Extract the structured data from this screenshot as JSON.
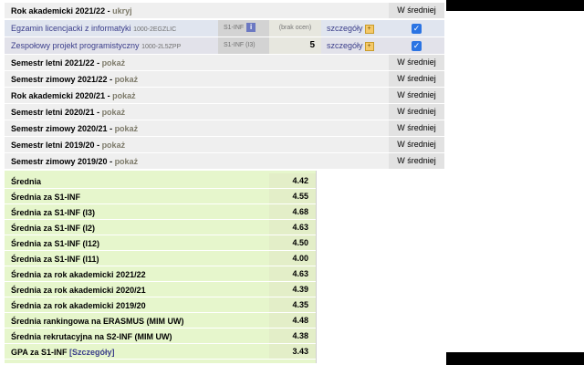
{
  "semesters": [
    {
      "name": "Rok akademicki 2021/22",
      "action": "ukryj",
      "avg_header": "W średniej"
    },
    {
      "name": "Semestr letni 2021/22",
      "action": "pokaż",
      "avg_header": "W średniej"
    },
    {
      "name": "Semestr zimowy 2021/22",
      "action": "pokaż",
      "avg_header": "W średniej"
    },
    {
      "name": "Rok akademicki 2020/21",
      "action": "pokaż",
      "avg_header": "W średniej"
    },
    {
      "name": "Semestr letni 2020/21",
      "action": "pokaż",
      "avg_header": "W średniej"
    },
    {
      "name": "Semestr zimowy 2020/21",
      "action": "pokaż",
      "avg_header": "W średniej"
    },
    {
      "name": "Semestr letni 2019/20",
      "action": "pokaż",
      "avg_header": "W średniej"
    },
    {
      "name": "Semestr zimowy 2019/20",
      "action": "pokaż",
      "avg_header": "W średniej"
    }
  ],
  "separator": " - ",
  "courses": [
    {
      "name": "Egzamin licencjacki z informatyki",
      "code": "1000-2EGZLIC",
      "group": "S1-INF",
      "grade": "(brak ocen)",
      "details": "szczegóły",
      "in_average": true
    },
    {
      "name": "Zespołowy projekt programistyczny",
      "code": "1000-2L5ZPP",
      "group": "S1-INF (I3)",
      "grade": "5",
      "details": "szczegóły",
      "in_average": true
    }
  ],
  "info_glyph": "i",
  "plus_glyph": "+",
  "check_glyph": "✓",
  "averages": [
    {
      "label": "Średnia",
      "value": "4.42"
    },
    {
      "label": "Średnia za S1-INF",
      "value": "4.55"
    },
    {
      "label": "Średnia za S1-INF (I3)",
      "value": "4.68"
    },
    {
      "label": "Średnia za S1-INF (I2)",
      "value": "4.63"
    },
    {
      "label": "Średnia za S1-INF (I12)",
      "value": "4.50"
    },
    {
      "label": "Średnia za S1-INF (I11)",
      "value": "4.00"
    },
    {
      "label": "Średnia za rok akademicki 2021/22",
      "value": "4.63"
    },
    {
      "label": "Średnia za rok akademicki 2020/21",
      "value": "4.39"
    },
    {
      "label": "Średnia za rok akademicki 2019/20",
      "value": "4.35"
    },
    {
      "label": "Średnia rankingowa na ERASMUS (MIM UW)",
      "value": "4.48"
    },
    {
      "label": "Średnia rekrutacyjna na S2-INF (MIM UW)",
      "value": "4.38"
    },
    {
      "label": "GPA za S1-INF",
      "link": "[Szczegóły]",
      "value": "3.43"
    }
  ]
}
